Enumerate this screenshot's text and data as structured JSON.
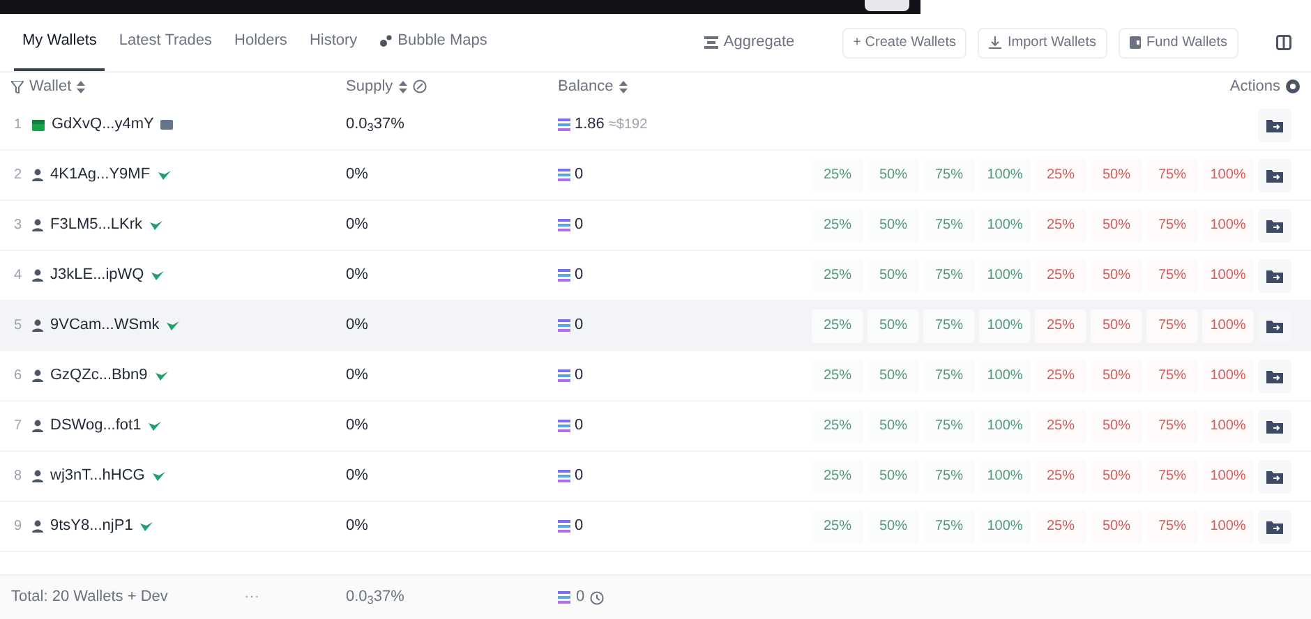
{
  "tabs": [
    {
      "label": "My Wallets",
      "selected": true,
      "kind": "plain"
    },
    {
      "label": "Latest Trades",
      "selected": false,
      "kind": "plain"
    },
    {
      "label": "Holders",
      "selected": false,
      "kind": "plain"
    },
    {
      "label": "History",
      "selected": false,
      "kind": "plain"
    },
    {
      "label": "Bubble Maps",
      "selected": false,
      "kind": "bubble"
    }
  ],
  "toolbar": {
    "aggregate": "Aggregate",
    "buttons": [
      {
        "label": "+ Create Wallets",
        "kind": "plain"
      },
      {
        "label": "Import Wallets",
        "kind": "import"
      },
      {
        "label": "Fund Wallets",
        "kind": "fund"
      }
    ]
  },
  "table": {
    "columns": {
      "wallet": "Wallet",
      "supply": "Supply",
      "balance": "Balance",
      "actions": "Actions"
    },
    "rows": [
      {
        "index": "1",
        "kind": "dev",
        "wallet": "GdXvQ...y4mY",
        "supply": "0.0$_{3}$37%",
        "balance": "1.86",
        "usd": "≈$192",
        "hovered": false
      },
      {
        "index": "2",
        "kind": "wallet",
        "wallet": "4K1Ag...Y9MF",
        "supply": "0%",
        "balance": "0",
        "hovered": false,
        "buy": [
          "25%",
          "50%",
          "75%",
          "100%"
        ],
        "sell": [
          "25%",
          "50%",
          "75%",
          "100%"
        ]
      },
      {
        "index": "3",
        "kind": "wallet",
        "wallet": "F3LM5...LKrk",
        "supply": "0%",
        "balance": "0",
        "hovered": false,
        "buy": [
          "25%",
          "50%",
          "75%",
          "100%"
        ],
        "sell": [
          "25%",
          "50%",
          "75%",
          "100%"
        ]
      },
      {
        "index": "4",
        "kind": "wallet",
        "wallet": "J3kLE...ipWQ",
        "supply": "0%",
        "balance": "0",
        "hovered": false,
        "buy": [
          "25%",
          "50%",
          "75%",
          "100%"
        ],
        "sell": [
          "25%",
          "50%",
          "75%",
          "100%"
        ]
      },
      {
        "index": "5",
        "kind": "wallet",
        "wallet": "9VCam...WSmk",
        "supply": "0%",
        "balance": "0",
        "hovered": true,
        "buy": [
          "25%",
          "50%",
          "75%",
          "100%"
        ],
        "sell": [
          "25%",
          "50%",
          "75%",
          "100%"
        ]
      },
      {
        "index": "6",
        "kind": "wallet",
        "wallet": "GzQZc...Bbn9",
        "supply": "0%",
        "balance": "0",
        "hovered": false,
        "buy": [
          "25%",
          "50%",
          "75%",
          "100%"
        ],
        "sell": [
          "25%",
          "50%",
          "75%",
          "100%"
        ]
      },
      {
        "index": "7",
        "kind": "wallet",
        "wallet": "DSWog...fot1",
        "supply": "0%",
        "balance": "0",
        "hovered": false,
        "buy": [
          "25%",
          "50%",
          "75%",
          "100%"
        ],
        "sell": [
          "25%",
          "50%",
          "75%",
          "100%"
        ]
      },
      {
        "index": "8",
        "kind": "wallet",
        "wallet": "wj3nT...hHCG",
        "supply": "0%",
        "balance": "0",
        "hovered": false,
        "buy": [
          "25%",
          "50%",
          "75%",
          "100%"
        ],
        "sell": [
          "25%",
          "50%",
          "75%",
          "100%"
        ]
      },
      {
        "index": "9",
        "kind": "wallet",
        "wallet": "9tsY8...njP1",
        "supply": "0%",
        "balance": "0",
        "hovered": false,
        "buy": [
          "25%",
          "50%",
          "75%",
          "100%"
        ],
        "sell": [
          "25%",
          "50%",
          "75%",
          "100%"
        ]
      }
    ]
  },
  "footer": {
    "total": "Total: 20 Wallets + Dev",
    "more": "···",
    "supply": "0.0$_{3}$37%",
    "balance": "0"
  }
}
